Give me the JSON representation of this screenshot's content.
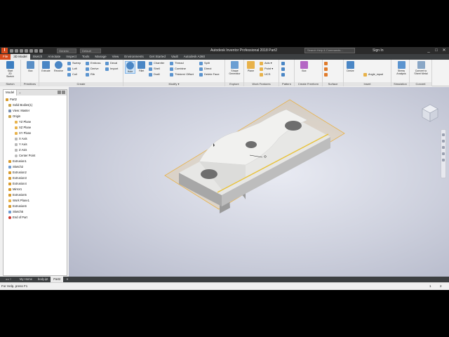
{
  "titlebar": {
    "logo": "I",
    "quick_access": [
      "new-icon",
      "open-icon",
      "save-icon",
      "undo-icon",
      "redo-icon",
      "home-icon",
      "select-icon"
    ],
    "material": "Generic",
    "appearance": "Default",
    "window_title": "Autodesk Inventor Professional 2018    Part2",
    "search_placeholder": "Search Help & Commands...",
    "sign_in": "Sign In",
    "controls": [
      "_",
      "□",
      "✕"
    ]
  },
  "ribbon_tabs": [
    "File",
    "3D Model",
    "Sketch",
    "Annotate",
    "Inspect",
    "Tools",
    "Manage",
    "View",
    "Environments",
    "Get Started",
    "Vault",
    "Autodesk A360"
  ],
  "active_tab": "3D Model",
  "ribbon": {
    "sketch": {
      "start_label": "Start\n2D Sketch",
      "group": "Sketch"
    },
    "primitives": {
      "box_label": "Box",
      "group": "Primitives"
    },
    "create": {
      "extrude": "Extrude",
      "revolve": "Revolve",
      "sweep": "Sweep",
      "loft": "Loft",
      "coil": "Coil",
      "emboss": "Emboss",
      "derive": "Derive",
      "rib": "Rib",
      "decal": "Decal",
      "import": "Import",
      "group": "Create"
    },
    "modify": {
      "hole": "Hole",
      "fillet": "Fillet",
      "chamfer": "Chamfer",
      "shell": "Shell",
      "draft": "Draft",
      "thread": "Thread",
      "combine": "Combine",
      "thicken": "Thicken/ Offset",
      "split": "Split",
      "direct": "Direct",
      "delete_face": "Delete Face",
      "group": "Modify ▾"
    },
    "explore": {
      "shape_generator": "Shape\nGenerator",
      "group": "Explore"
    },
    "work_features": {
      "plane": "Plane",
      "axis": "Axis ▾",
      "point": "Point ▾",
      "ucs": "UCS",
      "group": "Work Features"
    },
    "pattern": {
      "group": "Pattern"
    },
    "freeform": {
      "box": "Box",
      "group": "Create Freeform"
    },
    "surface": {
      "group": "Surface"
    },
    "insert": {
      "derive": "Derive",
      "param": "Angle_equal",
      "group": "Insert"
    },
    "simulation": {
      "stress": "Stress\nAnalysis",
      "group": "Simulation"
    },
    "convert": {
      "sheet_metal": "Convert to\nSheet Metal",
      "group": "Convert"
    }
  },
  "browser": {
    "tab": "Model",
    "tree": [
      {
        "label": "Part2",
        "icon": "part-icon",
        "level": 0
      },
      {
        "label": "Solid Bodies(1)",
        "icon": "folder-icon",
        "level": 1
      },
      {
        "label": "View: Master",
        "icon": "view-icon",
        "level": 1
      },
      {
        "label": "Origin",
        "icon": "folder-icon",
        "level": 1
      },
      {
        "label": "YZ Plane",
        "icon": "plane-icon",
        "level": 2
      },
      {
        "label": "XZ Plane",
        "icon": "plane-icon",
        "level": 2
      },
      {
        "label": "XY Plane",
        "icon": "plane-icon",
        "level": 2
      },
      {
        "label": "X Axis",
        "icon": "axis-icon",
        "level": 2
      },
      {
        "label": "Y Axis",
        "icon": "axis-icon",
        "level": 2
      },
      {
        "label": "Z Axis",
        "icon": "axis-icon",
        "level": 2
      },
      {
        "label": "Center Point",
        "icon": "point-icon",
        "level": 2
      },
      {
        "label": "Extrusion1",
        "icon": "extrusion-icon",
        "level": 1
      },
      {
        "label": "Sketch2",
        "icon": "sketch-icon",
        "level": 1
      },
      {
        "label": "Extrusion2",
        "icon": "extrusion-icon",
        "level": 1
      },
      {
        "label": "Extrusion3",
        "icon": "extrusion-icon",
        "level": 1
      },
      {
        "label": "Extrusion4",
        "icon": "extrusion-icon",
        "level": 1
      },
      {
        "label": "Mirror1",
        "icon": "mirror-icon",
        "level": 1
      },
      {
        "label": "Extrusion5",
        "icon": "extrusion-icon",
        "level": 1
      },
      {
        "label": "Work Plane1",
        "icon": "plane-icon",
        "level": 1
      },
      {
        "label": "Extrusion6",
        "icon": "extrusion-icon",
        "level": 1
      },
      {
        "label": "Sketch5",
        "icon": "sketch-icon",
        "level": 1
      },
      {
        "label": "End of Part",
        "icon": "end-icon",
        "level": 1
      }
    ]
  },
  "doc_tabs": [
    "My Home",
    "body.ipt",
    "Part2"
  ],
  "active_doc": "Part2",
  "status": {
    "text": "For Help, press F1",
    "n1": "1",
    "n2": "2"
  },
  "colors": {
    "accent": "#d64a1c",
    "work_plane": "#e8b24a"
  }
}
